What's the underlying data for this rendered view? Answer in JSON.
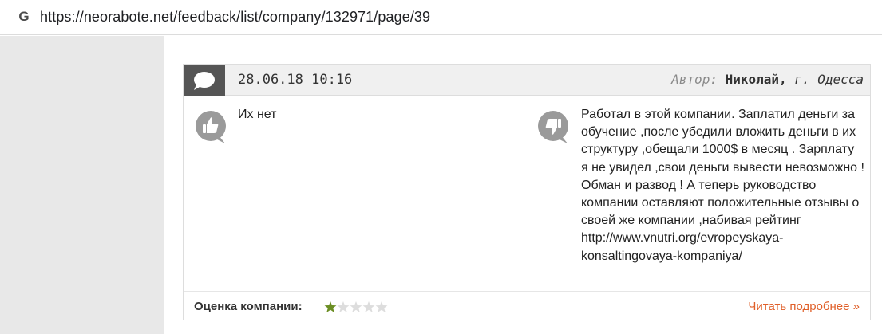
{
  "browser": {
    "url": "https://neorabote.net/feedback/list/company/132971/page/39"
  },
  "review": {
    "date": "28.06.18 10:16",
    "author_label": "Автор:",
    "author_name": "Николай,",
    "author_city": "г. Одесса",
    "pros": "Их нет",
    "cons": "Работал в этой компании. Заплатил деньги за обучение ,после убедили вложить деньги в их структуру ,обещали 1000$ в месяц . Зарплату я не увидел ,свои деньги вывести невозможно ! Обман и развод ! А теперь руководство компании оставляют положительные отзывы о своей же компании ,набивая рейтинг http://www.vnutri.org/evropeyskaya-konsaltingovaya-kompaniya/",
    "rating_label": "Оценка компании:",
    "rating": 1,
    "rating_max": 5,
    "read_more": "Читать подробнее »"
  },
  "colors": {
    "star_filled": "#6b8e23",
    "star_empty": "#dddddd",
    "link_orange": "#e0602a",
    "header_dark": "#555555"
  },
  "icons": {
    "browser": "google-g-icon",
    "comment": "speech-bubble-icon",
    "pros": "thumbs-up-icon",
    "cons": "thumbs-down-icon",
    "rating": "star-icon"
  }
}
